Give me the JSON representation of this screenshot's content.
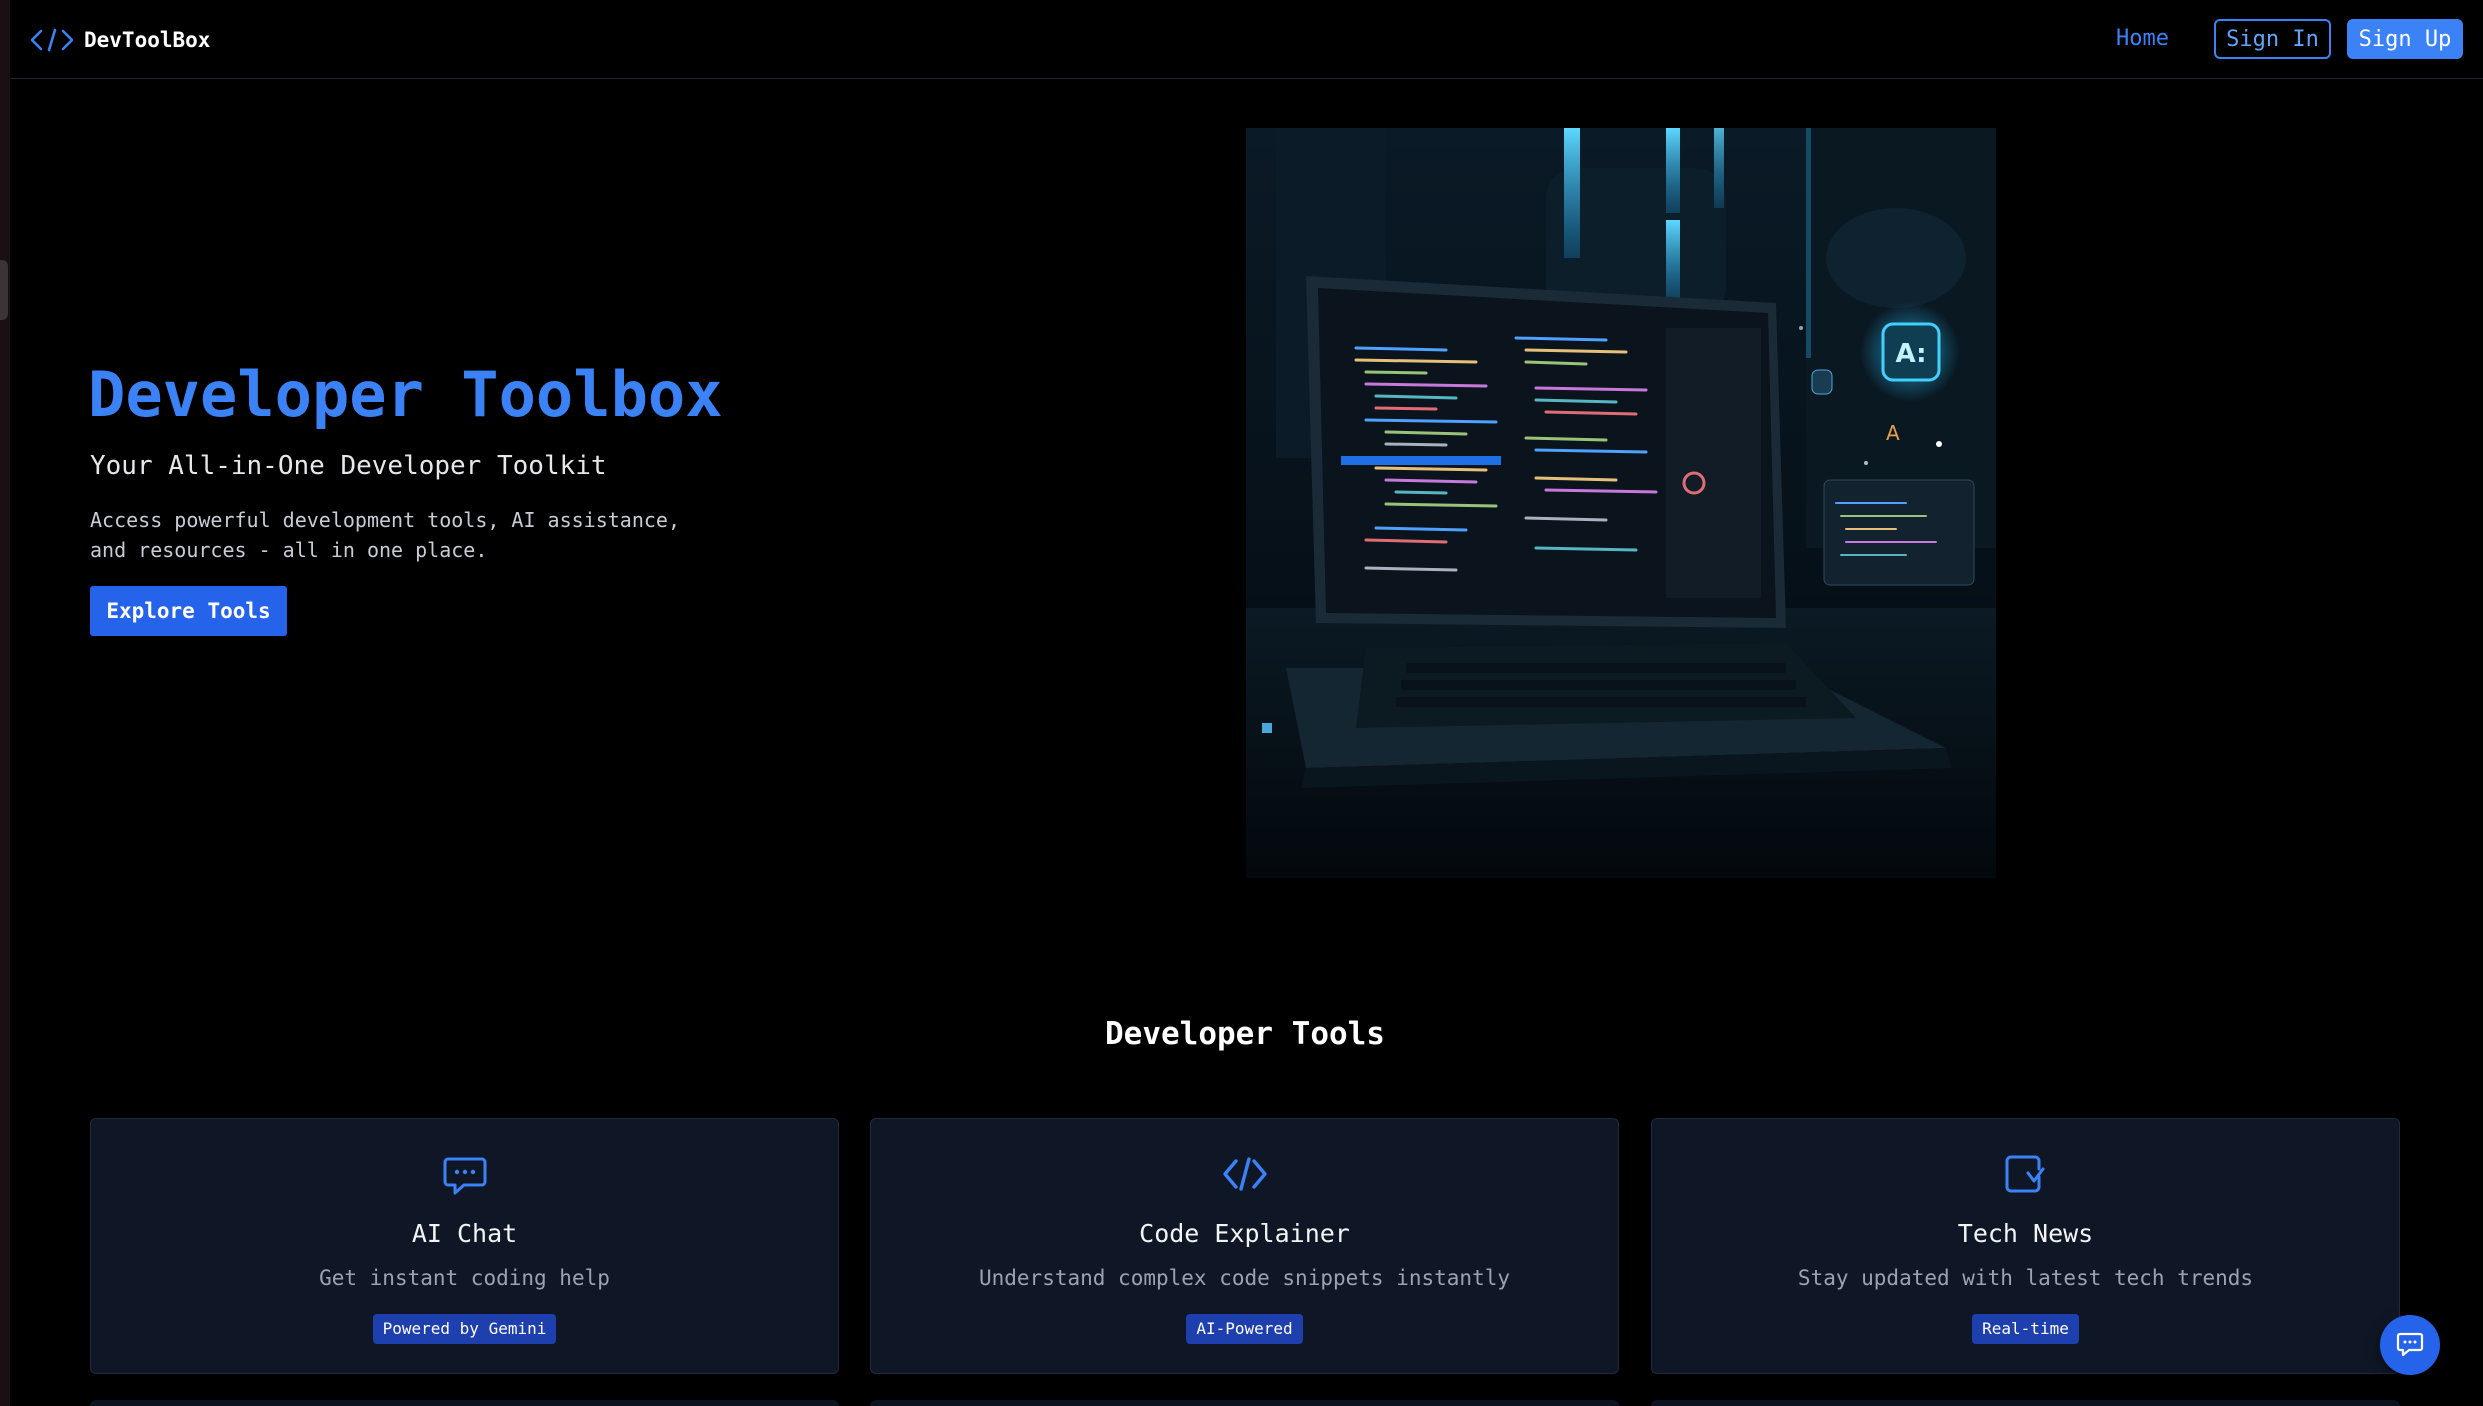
{
  "header": {
    "brand_text": "DevToolBox",
    "brand_icon": "code-brackets-icon",
    "nav_home": "Home",
    "sign_in": "Sign In",
    "sign_up": "Sign Up"
  },
  "hero": {
    "title": "Developer Toolbox",
    "subtitle": "Your All-in-One Developer Toolkit",
    "description": "Access powerful development tools, AI assistance, and resources - all in one place.",
    "cta": "Explore Tools",
    "image": "laptop-code-editor-illustration"
  },
  "tools": {
    "section_title": "Developer Tools",
    "cards": [
      {
        "icon": "chat-bubble-icon",
        "title": "AI Chat",
        "description": "Get instant coding help",
        "badge": "Powered by Gemini"
      },
      {
        "icon": "code-icon",
        "title": "Code Explainer",
        "description": "Understand complex code snippets instantly",
        "badge": "AI-Powered"
      },
      {
        "icon": "news-icon",
        "title": "Tech News",
        "description": "Stay updated with latest tech trends",
        "badge": "Real-time"
      }
    ]
  },
  "floating": {
    "chat_button_icon": "chat-bubble-icon"
  },
  "colors": {
    "background": "#000000",
    "accent": "#3b82f6",
    "button": "#2563eb",
    "card_bg": "#0f1726",
    "badge_bg": "#1e40af",
    "muted_text": "#9ca3af"
  }
}
